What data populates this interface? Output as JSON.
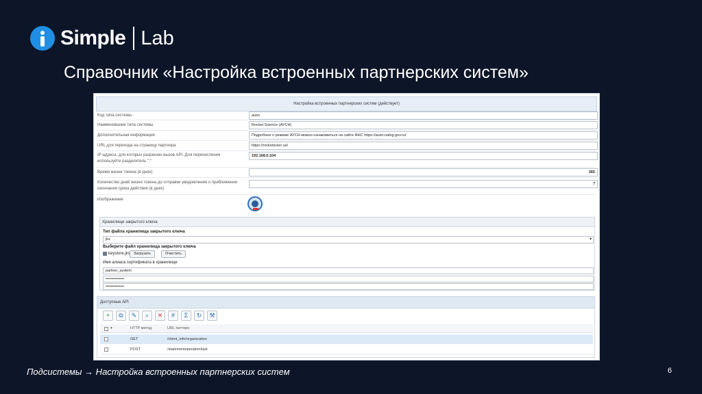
{
  "brand": {
    "name": "Simple",
    "suffix": "Lab"
  },
  "slide": {
    "title": "Справочник «Настройка встроенных партнерских систем»",
    "breadcrumb": "Подсистемы → Настройка встроенных партнерских систем",
    "page_number": "6"
  },
  "form": {
    "header": "Настройка встроенных партнерских систем (действует)",
    "fields": [
      {
        "label": "Код типа системы",
        "value": "ausn"
      },
      {
        "label": "Наименование типа системы",
        "value": "Rocket Science (АУСН)"
      },
      {
        "label": "Дополнительная информация",
        "value": "Подробнее о режиме АУСН можно ознакомиться на сайте ФНС https://ausn.nalog.gov.ru/"
      },
      {
        "label": "URL для перехода на страницу партнера",
        "value": "https://rocketscien.se/"
      },
      {
        "label": "IP-адреса, для которых разрешен вызов API. Для перечисления используйте разделитель \";\"",
        "value": "192.168.0.104"
      },
      {
        "label": "Время жизни токена (в днях)",
        "value": "365"
      },
      {
        "label": "Количество дней жизни токена до отправки уведомления о приближении окончания срока действия (в днях)",
        "value": "7"
      }
    ],
    "image_label": "Изображение"
  },
  "keystore": {
    "title": "Хранилище закрытого ключа",
    "type_label": "Тип файла хранилища закрытого ключа",
    "type_value": "jks",
    "file_label": "Выберите файл хранилища закрытого ключа",
    "file_name": "keystore.jks",
    "upload_button": "Загрузить",
    "clear_button": "Очистить",
    "alias_label": "Имя алиаса сертификата в хранилище",
    "alias_value": "partner_system",
    "password1": "••••••••••••••",
    "password2": "••••••••••••••"
  },
  "api": {
    "title": "Доступные API",
    "columns": {
      "method": "HTTP метод",
      "url": "URL паттерн"
    },
    "rows": [
      {
        "method": "GET",
        "url": "/client_info/organization"
      },
      {
        "method": "POST",
        "url": "/statementoperation/last"
      }
    ]
  }
}
